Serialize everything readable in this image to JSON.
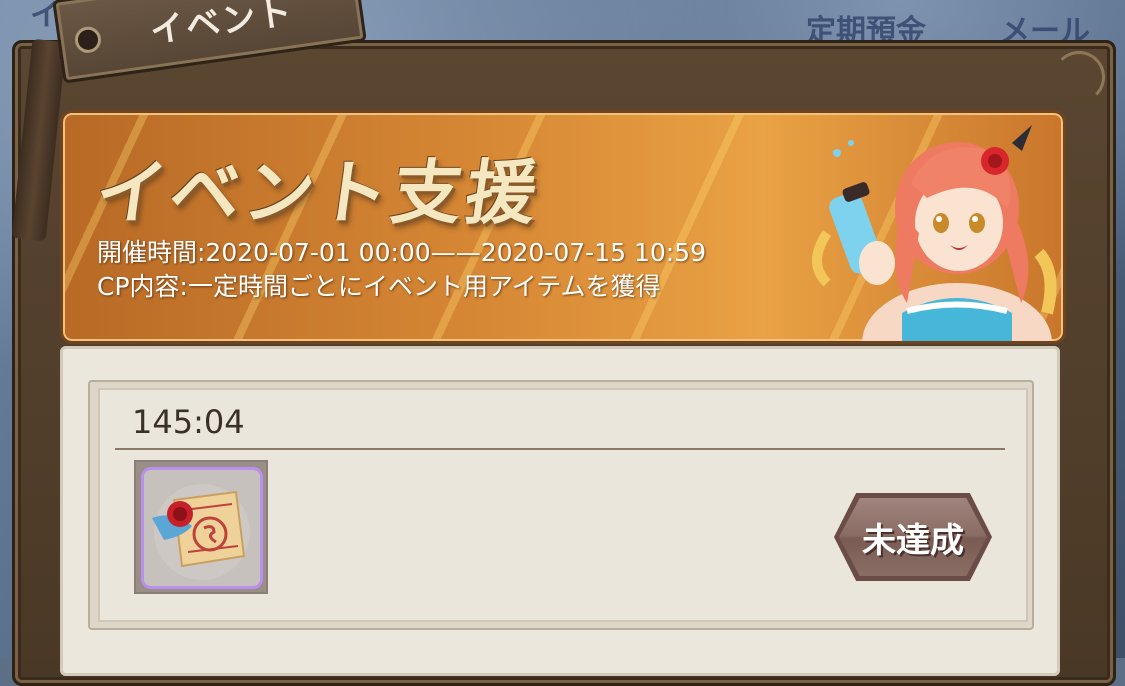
{
  "background": {
    "text_left": "イベント",
    "text_mid": "定期預金",
    "text_right": "メール"
  },
  "window": {
    "tab_label": "イベント"
  },
  "banner": {
    "title": "イベント支援",
    "period": "開催時間:2020-07-01 00:00——2020-07-15 10:59",
    "content": "CP内容:一定時間ごとにイベント用アイテムを獲得"
  },
  "mission": {
    "timer": "145:04",
    "item_icon": "sealed-scroll-icon",
    "status_label": "未達成"
  },
  "colors": {
    "banner_accent": "#e09a40",
    "panel_frame": "#4a3826",
    "item_rarity_border": "#b98ff0",
    "status_button": "#8a6c64"
  }
}
